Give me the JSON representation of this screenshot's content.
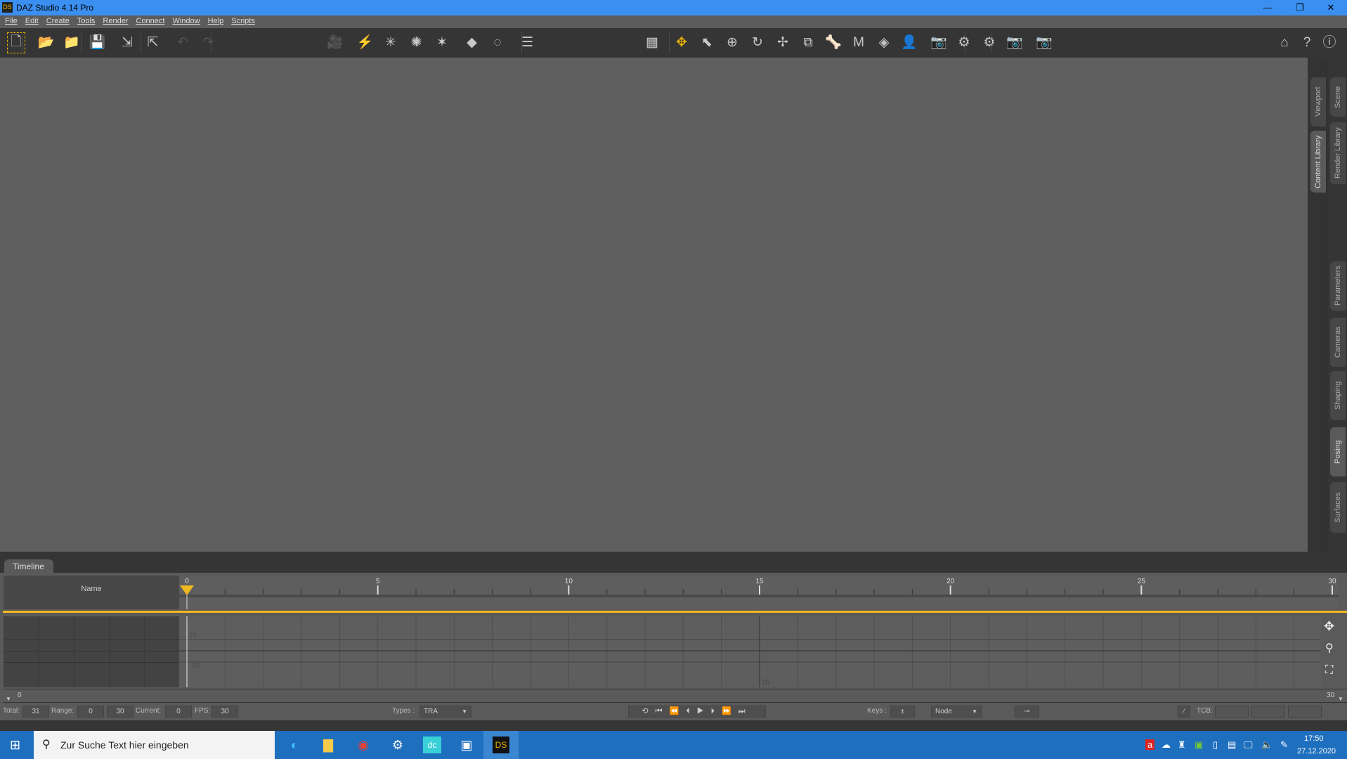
{
  "window": {
    "logo": "DS",
    "title": "DAZ Studio 4.14 Pro",
    "minimize": "—",
    "restore": "❐",
    "close": "✕"
  },
  "menu": [
    "File",
    "Edit",
    "Create",
    "Tools",
    "Render",
    "Connect",
    "Window",
    "Help",
    "Scripts"
  ],
  "toolbar_left": [
    {
      "name": "new-scene-icon",
      "glyph": "🗋"
    },
    {
      "name": "open-icon",
      "glyph": "📂"
    },
    {
      "name": "merge-icon",
      "glyph": "📁"
    },
    {
      "name": "save-icon",
      "glyph": "💾"
    },
    {
      "name": "import-icon",
      "glyph": "⇲"
    },
    {
      "name": "export-icon",
      "glyph": "⇱"
    },
    {
      "name": "undo-icon",
      "glyph": "↶",
      "disabled": true
    },
    {
      "name": "redo-icon",
      "glyph": "↷",
      "disabled": true
    },
    {
      "name": "create-camera-icon",
      "glyph": "🎥"
    },
    {
      "name": "create-spotlight-icon",
      "glyph": "⚡"
    },
    {
      "name": "create-pointlight-icon",
      "glyph": "✳"
    },
    {
      "name": "create-distant-light-icon",
      "glyph": "✺"
    },
    {
      "name": "create-light-icon",
      "glyph": "✶"
    },
    {
      "name": "create-primitive-icon",
      "glyph": "◆"
    },
    {
      "name": "create-null-icon",
      "glyph": "◌"
    },
    {
      "name": "align-icon",
      "glyph": "☰"
    }
  ],
  "toolbar_right": [
    {
      "name": "grid-icon",
      "glyph": "▦"
    },
    {
      "name": "universal-tool-icon",
      "glyph": "✥"
    },
    {
      "name": "select-tool-icon",
      "glyph": "⬉"
    },
    {
      "name": "node-rotate-icon",
      "glyph": "⊕"
    },
    {
      "name": "rotate-icon",
      "glyph": "↻"
    },
    {
      "name": "translate-icon",
      "glyph": "✢"
    },
    {
      "name": "scale-icon",
      "glyph": "⧉"
    },
    {
      "name": "joint-editor-icon",
      "glyph": "🦴"
    },
    {
      "name": "geometry-editor-icon",
      "glyph": "M"
    },
    {
      "name": "surface-selection-icon",
      "glyph": "◈"
    },
    {
      "name": "figure-icon",
      "glyph": "👤"
    },
    {
      "name": "camera-tool-icon",
      "glyph": "📷"
    },
    {
      "name": "select-settings-icon",
      "glyph": "⚙"
    },
    {
      "name": "render-settings-icon",
      "glyph": "⚙"
    },
    {
      "name": "render-camera-settings-icon",
      "glyph": "📷"
    },
    {
      "name": "render-icon",
      "glyph": "📷"
    }
  ],
  "toolbar_far_right": [
    {
      "name": "daz-home-icon",
      "glyph": "⌂"
    },
    {
      "name": "whats-this-icon",
      "glyph": "?"
    },
    {
      "name": "help-icon",
      "glyph": "ⓘ"
    }
  ],
  "side_tabs_left": [
    "Viewport",
    "Content Library"
  ],
  "side_tabs_right_top": [
    "Scene",
    "Render Library"
  ],
  "side_tabs_right_bottom": [
    "Parameters",
    "Cameras",
    "Shaping",
    "Posing",
    "Surfaces"
  ],
  "timeline": {
    "tab": "Timeline",
    "name_header": "Name",
    "ruler": {
      "start": 0,
      "end": 30,
      "label_step": 5,
      "current": 0
    },
    "graph_labels": [
      "10",
      "-10",
      "15"
    ],
    "frame_start": "0",
    "frame_end": "30",
    "total_label": "Total:",
    "total": "31",
    "range_label": "Range:",
    "range_start": "0",
    "range_end": "30",
    "current_label": "Current:",
    "current": "0",
    "fps_label": "FPS:",
    "fps": "30",
    "types_label": "Types :",
    "types_value": "TRA",
    "keys_label": "Keys :",
    "keys_value": "Node",
    "tcb_label": "TCB:"
  },
  "taskbar": {
    "search_placeholder": "Zur Suche Text hier eingeben",
    "time": "17:50",
    "date": "27.12.2020"
  },
  "colors": {
    "accent": "#f0b820",
    "titlebar": "#3a8ff0",
    "taskbar": "#1f6fbf"
  }
}
